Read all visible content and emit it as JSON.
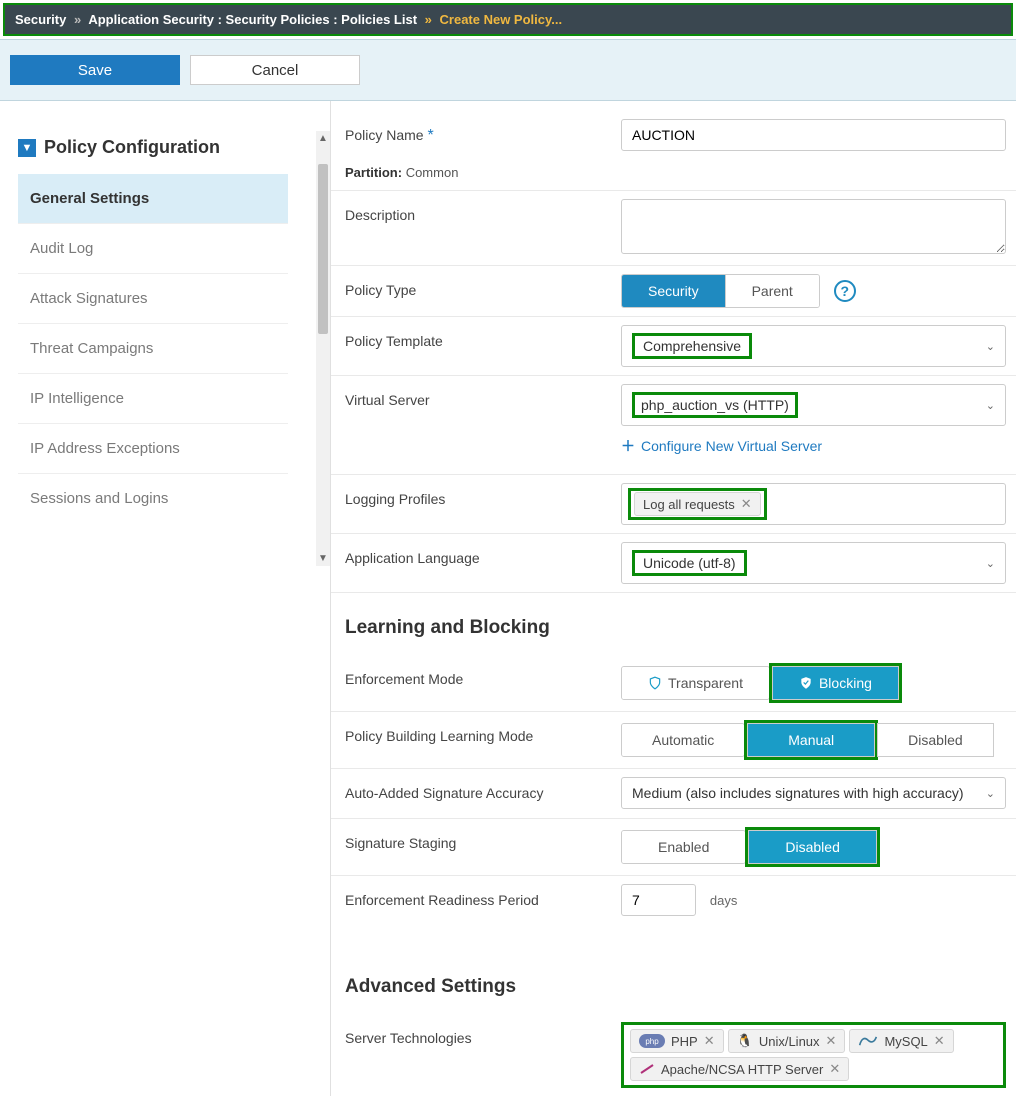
{
  "breadcrumb": {
    "root": "Security",
    "path1": "Application Security : Security Policies : Policies List",
    "current": "Create New Policy..."
  },
  "buttons": {
    "save": "Save",
    "cancel": "Cancel"
  },
  "sidebar": {
    "title": "Policy Configuration",
    "items": [
      "General Settings",
      "Audit Log",
      "Attack Signatures",
      "Threat Campaigns",
      "IP Intelligence",
      "IP Address Exceptions",
      "Sessions and Logins"
    ],
    "active_index": 0
  },
  "form": {
    "policy_name": {
      "label": "Policy Name",
      "value": "AUCTION",
      "partition_label": "Partition:",
      "partition_value": "Common"
    },
    "description": {
      "label": "Description",
      "value": ""
    },
    "policy_type": {
      "label": "Policy Type",
      "options": [
        "Security",
        "Parent"
      ],
      "active": "Security"
    },
    "policy_template": {
      "label": "Policy Template",
      "value": "Comprehensive"
    },
    "virtual_server": {
      "label": "Virtual Server",
      "value": "php_auction_vs (HTTP)",
      "link": "Configure New Virtual Server"
    },
    "logging_profiles": {
      "label": "Logging Profiles",
      "tags": [
        "Log all requests"
      ]
    },
    "application_language": {
      "label": "Application Language",
      "value": "Unicode (utf-8)"
    }
  },
  "learning": {
    "title": "Learning and Blocking",
    "enforcement_mode": {
      "label": "Enforcement Mode",
      "options": [
        "Transparent",
        "Blocking"
      ],
      "active": "Blocking"
    },
    "learning_mode": {
      "label": "Policy Building Learning Mode",
      "options": [
        "Automatic",
        "Manual",
        "Disabled"
      ],
      "active": "Manual"
    },
    "signature_accuracy": {
      "label": "Auto-Added Signature Accuracy",
      "value": "Medium (also includes signatures with high accuracy)"
    },
    "signature_staging": {
      "label": "Signature Staging",
      "options": [
        "Enabled",
        "Disabled"
      ],
      "active": "Disabled"
    },
    "enforcement_readiness": {
      "label": "Enforcement Readiness Period",
      "value": "7",
      "unit": "days"
    }
  },
  "advanced": {
    "title": "Advanced Settings",
    "server_technologies": {
      "label": "Server Technologies",
      "tags": [
        "PHP",
        "Unix/Linux",
        "MySQL",
        "Apache/NCSA HTTP Server"
      ]
    }
  }
}
